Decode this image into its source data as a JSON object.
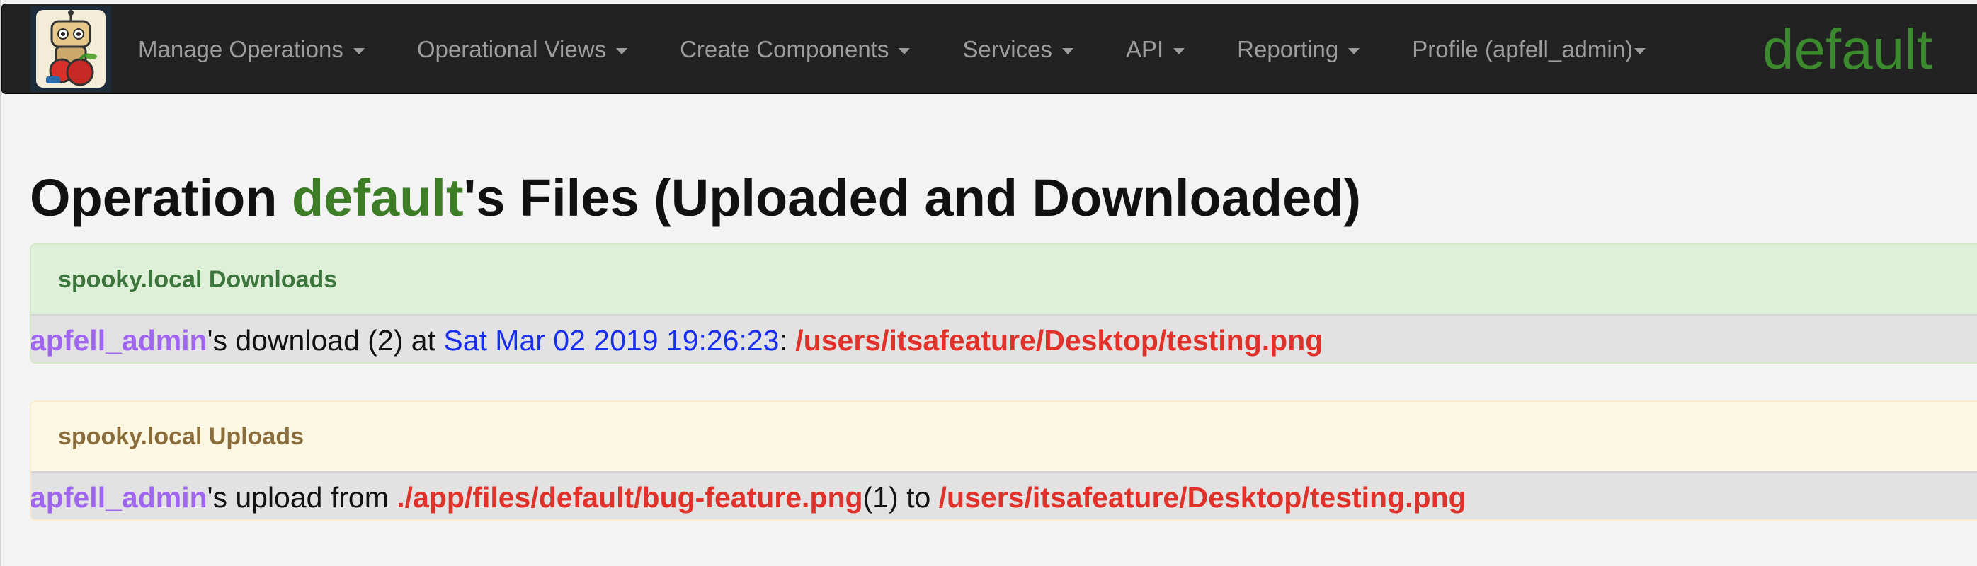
{
  "navbar": {
    "items": [
      {
        "label": "Manage Operations"
      },
      {
        "label": "Operational Views"
      },
      {
        "label": "Create Components"
      },
      {
        "label": "Services"
      },
      {
        "label": "API"
      },
      {
        "label": "Reporting"
      },
      {
        "label": "Profile (apfell_admin)"
      }
    ],
    "current_operation": "default"
  },
  "colors": {
    "navbar_bg": "#222222",
    "nav_text": "#9d9d9d",
    "operation_green": "#3c8a2e",
    "user_purple": "#a066f0",
    "timestamp_blue": "#1a2ef0",
    "path_red": "#e0312a"
  },
  "page": {
    "title_prefix": "Operation ",
    "title_operation": "default",
    "title_suffix": "'s Files (Uploaded and Downloaded)"
  },
  "downloads": {
    "heading": "spooky.local Downloads",
    "entries": [
      {
        "user": "apfell_admin",
        "text_a": "'s download (2) at ",
        "timestamp": "Sat Mar 02 2019 19:26:23",
        "text_b": ": ",
        "path": "/users/itsafeature/Desktop/testing.png"
      }
    ]
  },
  "uploads": {
    "heading": "spooky.local Uploads",
    "entries": [
      {
        "user": "apfell_admin",
        "text_a": "'s upload from ",
        "source": "./app/files/default/bug-feature.png",
        "text_b": "(1) to ",
        "path": "/users/itsafeature/Desktop/testing.png"
      }
    ]
  },
  "icons": {
    "logo": "apfell-logo-icon",
    "dropdown": "caret-down-icon"
  }
}
